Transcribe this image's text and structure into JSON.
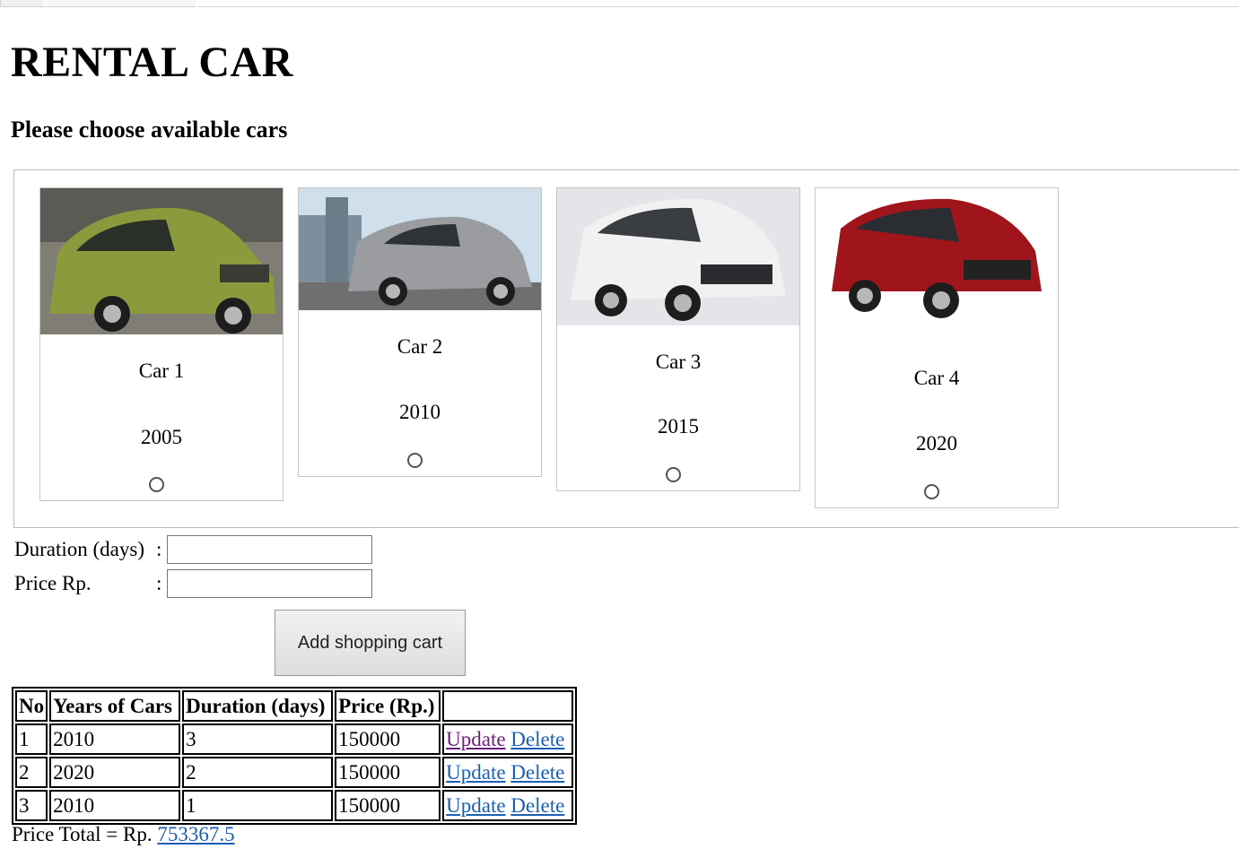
{
  "page": {
    "title": "RENTAL CAR",
    "subtitle": "Please choose available cars"
  },
  "cars": [
    {
      "name": "Car 1",
      "year": "2005",
      "body_color": "#8a9a3c",
      "selected": false
    },
    {
      "name": "Car 2",
      "year": "2010",
      "body_color": "#9a9ca0",
      "selected": false
    },
    {
      "name": "Car 3",
      "year": "2015",
      "body_color": "#f1f1f1",
      "selected": false
    },
    {
      "name": "Car 4",
      "year": "2020",
      "body_color": "#a0141c",
      "selected": false
    }
  ],
  "form": {
    "duration_label": "Duration (days)",
    "duration_value": "",
    "price_label": "Price Rp.",
    "price_value": "",
    "colon": ":",
    "add_button": "Add shopping cart"
  },
  "cart": {
    "headers": [
      "No",
      "Years of Cars",
      "Duration (days)",
      "Price (Rp.)",
      ""
    ],
    "rows": [
      {
        "no": "1",
        "year": "2010",
        "duration": "3",
        "price": "150000",
        "update": "Update",
        "delete": "Delete"
      },
      {
        "no": "2",
        "year": "2020",
        "duration": "2",
        "price": "150000",
        "update": "Update",
        "delete": "Delete"
      },
      {
        "no": "3",
        "year": "2010",
        "duration": "1",
        "price": "150000",
        "update": "Update",
        "delete": "Delete"
      }
    ]
  },
  "total": {
    "label": "Price Total = Rp.",
    "value": "753367.5"
  },
  "colors": {
    "link": "#1a5fb4",
    "visited_link": "#6b1d7a"
  }
}
